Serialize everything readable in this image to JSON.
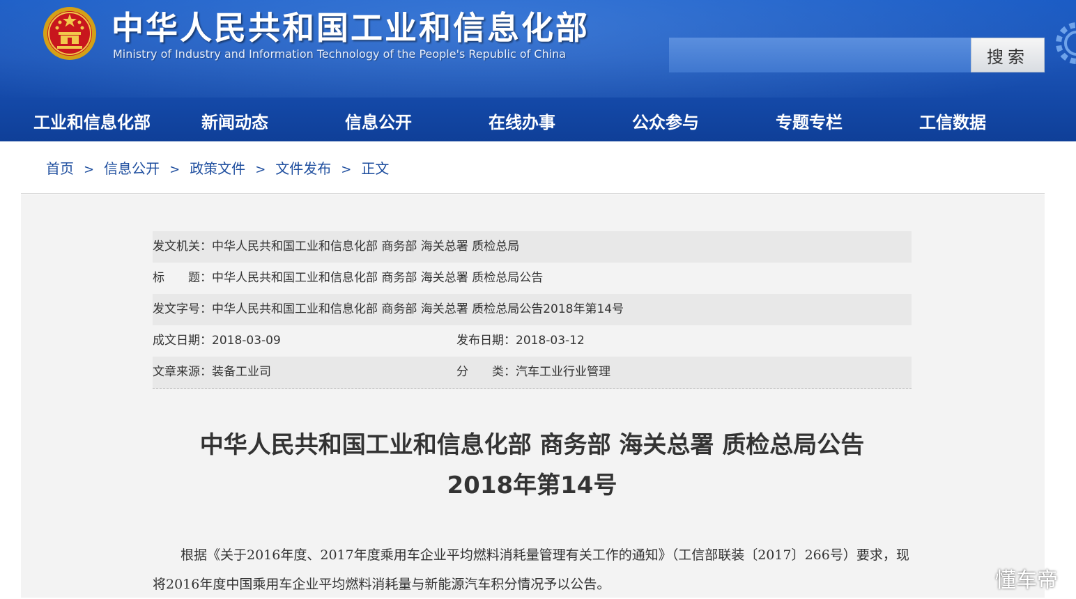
{
  "header": {
    "title": "中华人民共和国工业和信息化部",
    "subtitle": "Ministry of Industry and Information Technology of the People's Republic of China",
    "search_placeholder": "",
    "search_button": "搜索"
  },
  "nav": [
    "工业和信息化部",
    "新闻动态",
    "信息公开",
    "在线办事",
    "公众参与",
    "专题专栏",
    "工信数据"
  ],
  "breadcrumb": {
    "items": [
      "首页",
      "信息公开",
      "政策文件",
      "文件发布",
      "正文"
    ],
    "separator": ">"
  },
  "meta": {
    "issuer": "发文机关：中华人民共和国工业和信息化部 商务部 海关总署 质检总局",
    "title": "标　　题：中华人民共和国工业和信息化部 商务部 海关总署 质检总局公告",
    "doc_number": "发文字号：中华人民共和国工业和信息化部 商务部 海关总署 质检总局公告2018年第14号",
    "created_date": "成文日期：2018-03-09",
    "published_date": "发布日期：2018-03-12",
    "source": "文章来源：装备工业司",
    "category": "分　　类：汽车工业行业管理"
  },
  "document": {
    "title_line1": "中华人民共和国工业和信息化部 商务部 海关总署 质检总局公告",
    "title_line2": "2018年第14号",
    "paragraph": "根据《关于2016年度、2017年度乘用车企业平均燃料消耗量管理有关工作的通知》（工信部联装〔2017〕266号）要求，现将2016年度中国乘用车企业平均燃料消耗量与新能源汽车积分情况予以公告。"
  },
  "watermark": "懂车帝",
  "colors": {
    "header_blue": "#1c55b8",
    "link_blue": "#1d4d9e",
    "panel_bg": "#f3f3f3",
    "row_stripe": "#e8e8e8"
  }
}
